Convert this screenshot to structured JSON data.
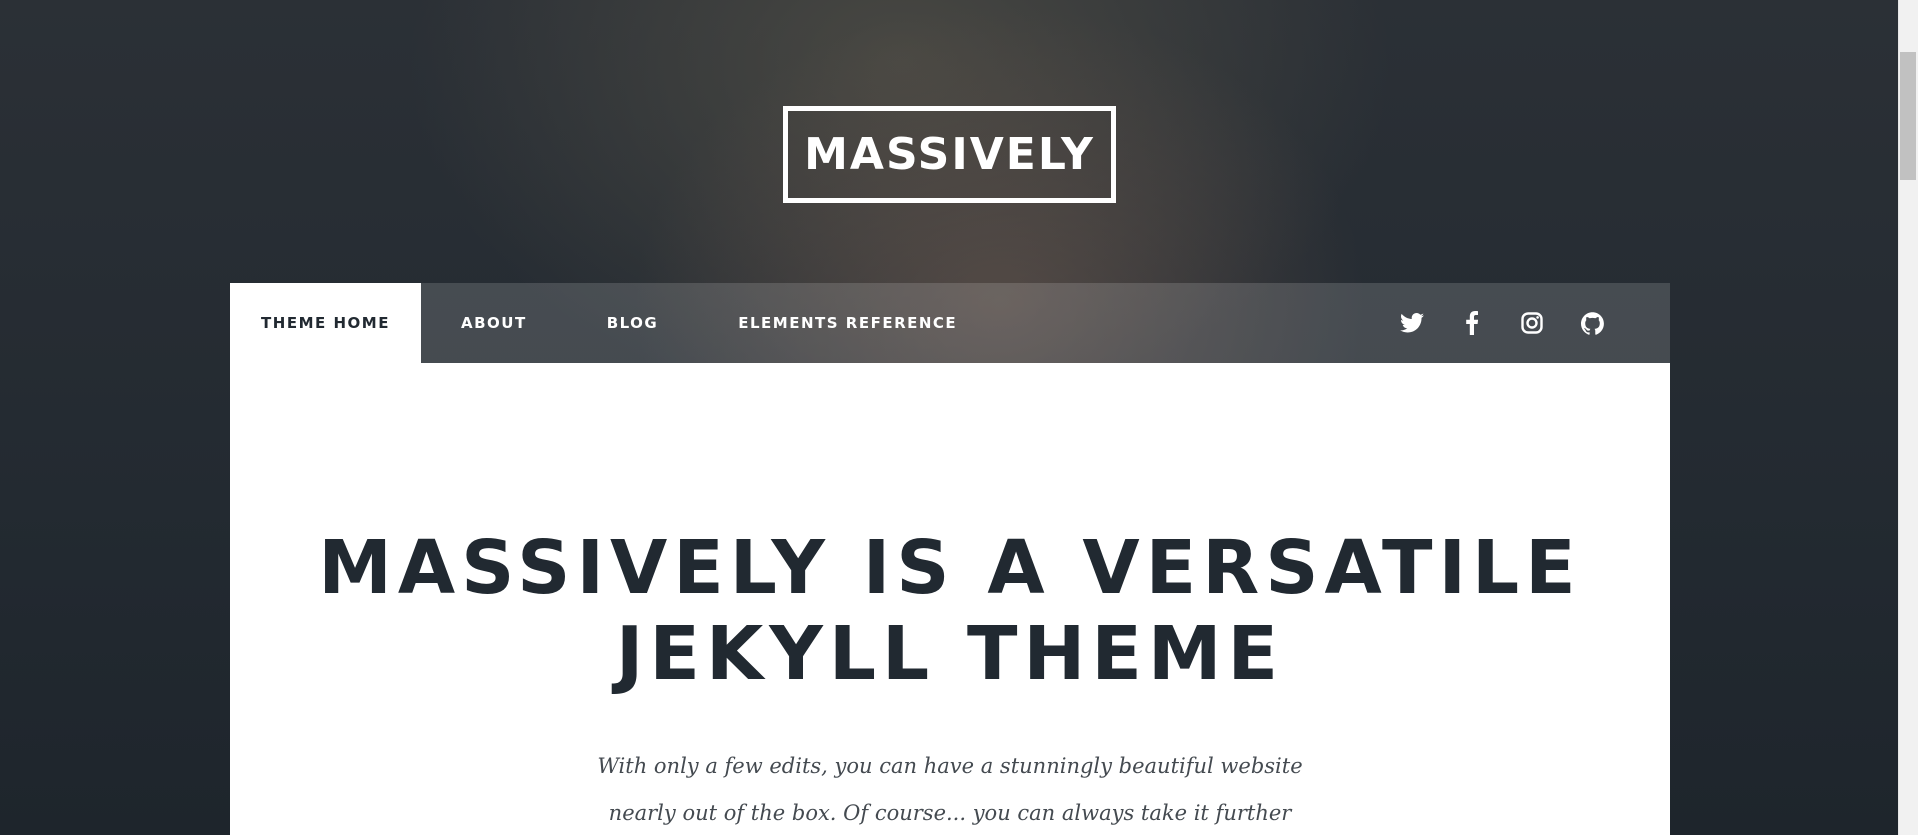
{
  "site": {
    "logo": "MASSIVELY"
  },
  "nav": {
    "items": [
      {
        "label": "THEME HOME",
        "active": true
      },
      {
        "label": "ABOUT",
        "active": false
      },
      {
        "label": "BLOG",
        "active": false
      },
      {
        "label": "ELEMENTS REFERENCE",
        "active": false
      }
    ],
    "social_icons": [
      "twitter-icon",
      "facebook-icon",
      "instagram-icon",
      "github-icon"
    ]
  },
  "main": {
    "headline_line1": "MASSIVELY IS A VERSATILE",
    "headline_line2": "JEKYLL THEME",
    "intro_line1": "With only a few edits, you can have a stunningly beautiful website",
    "intro_line2": "nearly out of the box. Of course... you can always take it further"
  },
  "colors": {
    "text_dark": "#212931",
    "nav_active_bg": "#ffffff",
    "icon": "#ffffff"
  }
}
